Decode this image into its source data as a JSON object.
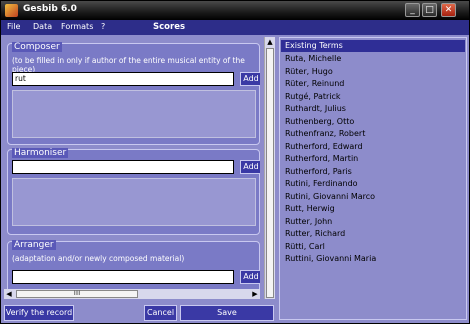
{
  "window": {
    "title": "Gesbib 6.0"
  },
  "menu": {
    "items": [
      "File",
      "Data",
      "Formats",
      "?"
    ],
    "form_title": "Scores"
  },
  "composer": {
    "title": "Composer",
    "subtitle": "(to be filled in only if author of the entire musical entity of the piece)",
    "value": "rut",
    "add_label": "Add"
  },
  "harmoniser": {
    "title": "Harmoniser",
    "value": "",
    "add_label": "Add"
  },
  "arranger": {
    "title": "Arranger",
    "subtitle": "(adaptation and/or newly composed material)",
    "value": "",
    "add_label": "Add"
  },
  "scroll": {
    "hthumb_grip": "IIII"
  },
  "existing_terms": {
    "header": "Existing Terms",
    "items": [
      "Ruta, Michelle",
      "Rüter, Hugo",
      "Rüter, Reinund",
      "Rutgé, Patrick",
      "Ruthardt, Julius",
      "Ruthenberg, Otto",
      "Ruthenfranz, Robert",
      "Rutherford, Edward",
      "Rutherford, Martin",
      "Rutherford, Paris",
      "Rutini, Ferdinando",
      "Rutini, Giovanni Marco",
      "Rutt, Herwig",
      "Rutter, John",
      "Rutter, Richard",
      "Rütti, Carl",
      "Ruttini, Giovanni Maria"
    ]
  },
  "buttons": {
    "verify": "Verify the record",
    "cancel": "Cancel",
    "save": "Save"
  }
}
